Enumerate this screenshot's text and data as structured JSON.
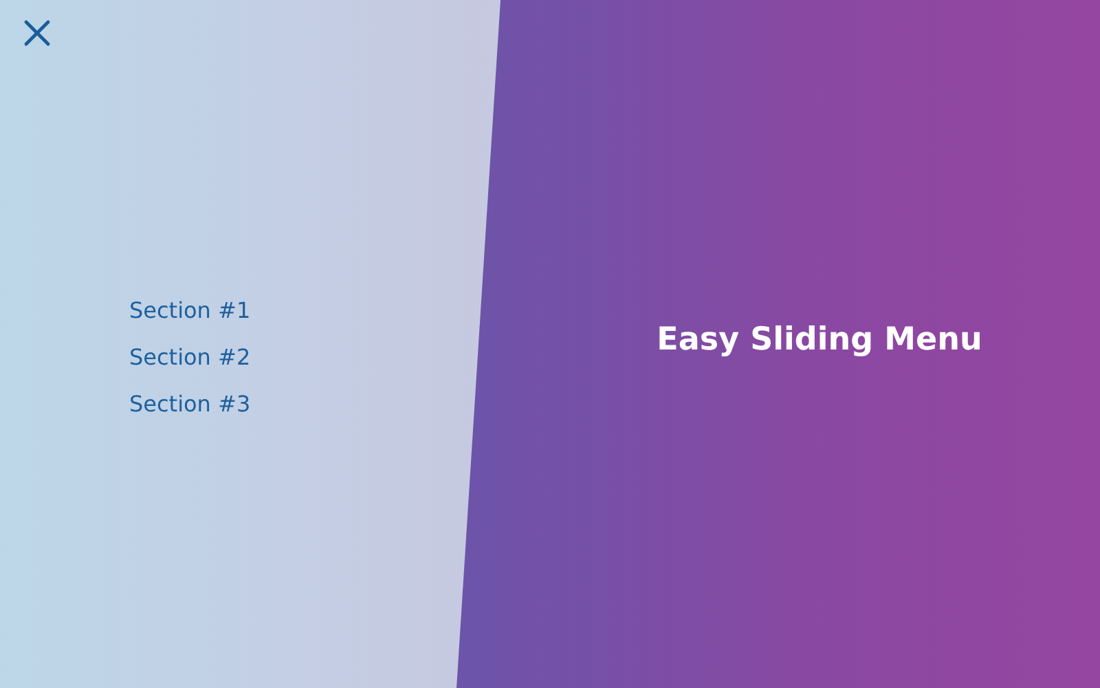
{
  "menu": {
    "items": [
      {
        "label": "Section #1"
      },
      {
        "label": "Section #2"
      },
      {
        "label": "Section #3"
      }
    ]
  },
  "main": {
    "title": "Easy Sliding Menu"
  }
}
